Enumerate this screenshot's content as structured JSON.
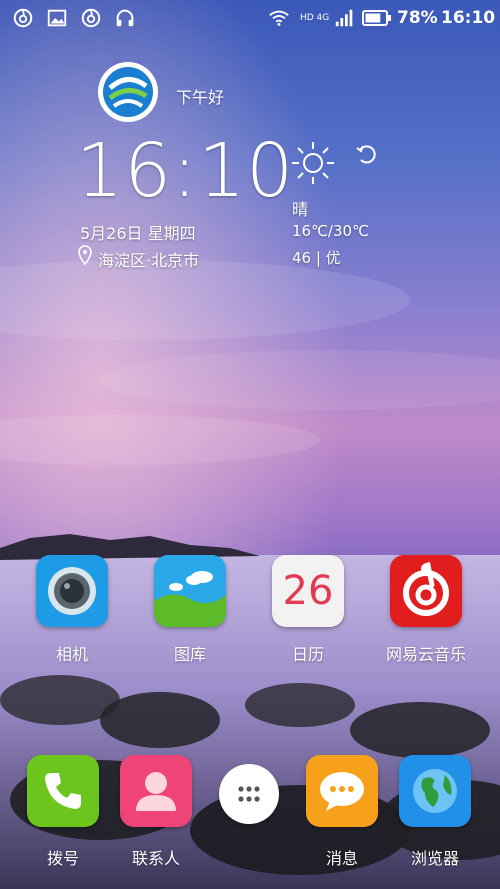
{
  "status_bar": {
    "left_icons": [
      "netease-music-icon",
      "gallery-icon",
      "netease-music-icon",
      "headset-icon"
    ],
    "network": "HD 4G",
    "battery": "78%",
    "time": "16:10"
  },
  "widget": {
    "greeting": "下午好",
    "clock": "16:10",
    "date": "5月26日 星期四",
    "location": "海淀区·北京市",
    "weather": {
      "condition": "晴",
      "temp_range": "16℃/30℃",
      "aqi": "46 | 优"
    }
  },
  "apps": [
    {
      "label": "相机",
      "icon": "camera-icon",
      "color": "#1e9be6"
    },
    {
      "label": "图库",
      "icon": "gallery-icon",
      "color": "#2ba8e8"
    },
    {
      "label": "日历",
      "icon": "calendar-icon",
      "color": "#f2f2f2",
      "day": "26"
    },
    {
      "label": "网易云音乐",
      "icon": "netease-music-icon",
      "color": "#e21d1d"
    }
  ],
  "dock": [
    {
      "label": "拨号",
      "icon": "phone-icon",
      "color": "#6cc51d"
    },
    {
      "label": "联系人",
      "icon": "contacts-icon",
      "color": "#ee4478"
    },
    {
      "label": "",
      "icon": "app-drawer-icon",
      "color": "#ffffff"
    },
    {
      "label": "消息",
      "icon": "message-icon",
      "color": "#f7a11a"
    },
    {
      "label": "浏览器",
      "icon": "browser-icon",
      "color": "#2190e8"
    }
  ]
}
